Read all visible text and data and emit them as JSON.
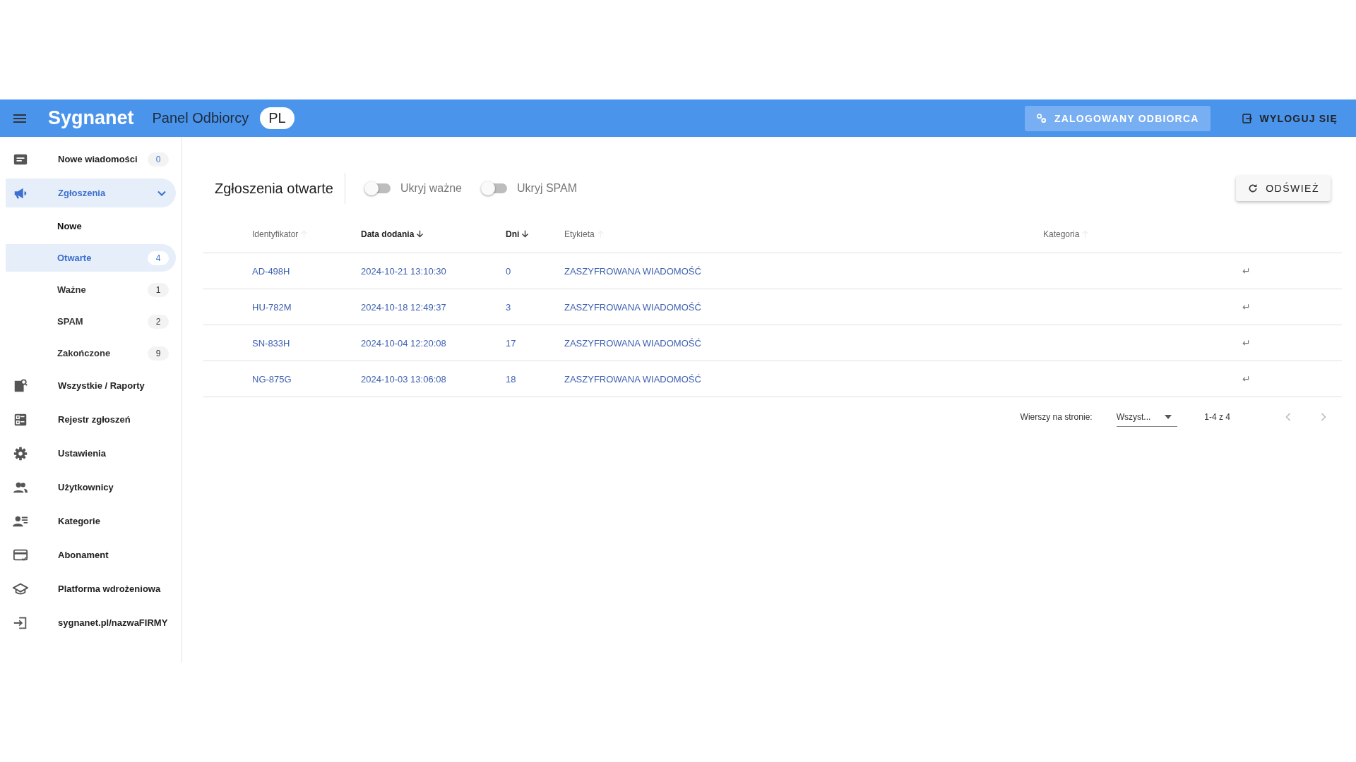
{
  "header": {
    "logo": "Sygnanet",
    "title": "Panel Odbiorcy",
    "language": "PL",
    "user_button": "ZALOGOWANY ODBIORCA",
    "logout_button": "WYLOGUJ SIĘ"
  },
  "sidebar": {
    "items": [
      {
        "label": "Nowe wiadomości",
        "badge": "0",
        "badge_highlighted": true,
        "selected": false
      },
      {
        "label": "Zgłoszenia",
        "selected": true,
        "expanded": true,
        "children": [
          {
            "label": "Nowe",
            "selected": false
          },
          {
            "label": "Otwarte",
            "badge": "4",
            "badge_highlighted": true,
            "selected": true
          },
          {
            "label": "Ważne",
            "badge": "1",
            "badge_highlighted": false,
            "selected": false
          },
          {
            "label": "SPAM",
            "badge": "2",
            "badge_highlighted": false,
            "selected": false
          },
          {
            "label": "Zakończone",
            "badge": "9",
            "badge_highlighted": false,
            "selected": false
          }
        ]
      },
      {
        "label": "Wszystkie / Raporty",
        "selected": false
      },
      {
        "label": "Rejestr zgłoszeń",
        "selected": false
      },
      {
        "label": "Ustawienia",
        "selected": false
      },
      {
        "label": "Użytkownicy",
        "selected": false
      },
      {
        "label": "Kategorie",
        "selected": false
      },
      {
        "label": "Abonament",
        "selected": false
      },
      {
        "label": "Platforma wdrożeniowa",
        "selected": false
      },
      {
        "label": "sygnanet.pl/nazwaFIRMY",
        "selected": false
      }
    ]
  },
  "content": {
    "title": "Zgłoszenia otwarte",
    "toggles": [
      {
        "label": "Ukryj ważne",
        "on": false
      },
      {
        "label": "Ukryj SPAM",
        "on": false
      }
    ],
    "refresh_button": "ODŚWIEŻ",
    "table": {
      "columns": [
        {
          "label": "Identyfikator",
          "sorted": false
        },
        {
          "label": "Data dodania",
          "sorted": true
        },
        {
          "label": "Dni",
          "sorted": true
        },
        {
          "label": "Etykieta",
          "sorted": false
        },
        {
          "label": "Kategoria",
          "sorted": false
        }
      ],
      "rows": [
        {
          "id": "AD-498H",
          "date": "2024-10-21 13:10:30",
          "days": "0",
          "label": "ZASZYFROWANA WIADOMOŚĆ",
          "action": "↵"
        },
        {
          "id": "HU-782M",
          "date": "2024-10-18 12:49:37",
          "days": "3",
          "label": "ZASZYFROWANA WIADOMOŚĆ",
          "action": "↵"
        },
        {
          "id": "SN-833H",
          "date": "2024-10-04 12:20:08",
          "days": "17",
          "label": "ZASZYFROWANA WIADOMOŚĆ",
          "action": "↵"
        },
        {
          "id": "NG-875G",
          "date": "2024-10-03 13:06:08",
          "days": "18",
          "label": "ZASZYFROWANA WIADOMOŚĆ",
          "action": "↵"
        }
      ]
    },
    "pagination": {
      "rows_per_page_label": "Wierszy na stronie:",
      "rows_per_page_value": "Wszyst...",
      "range": "1-4 z 4"
    }
  }
}
